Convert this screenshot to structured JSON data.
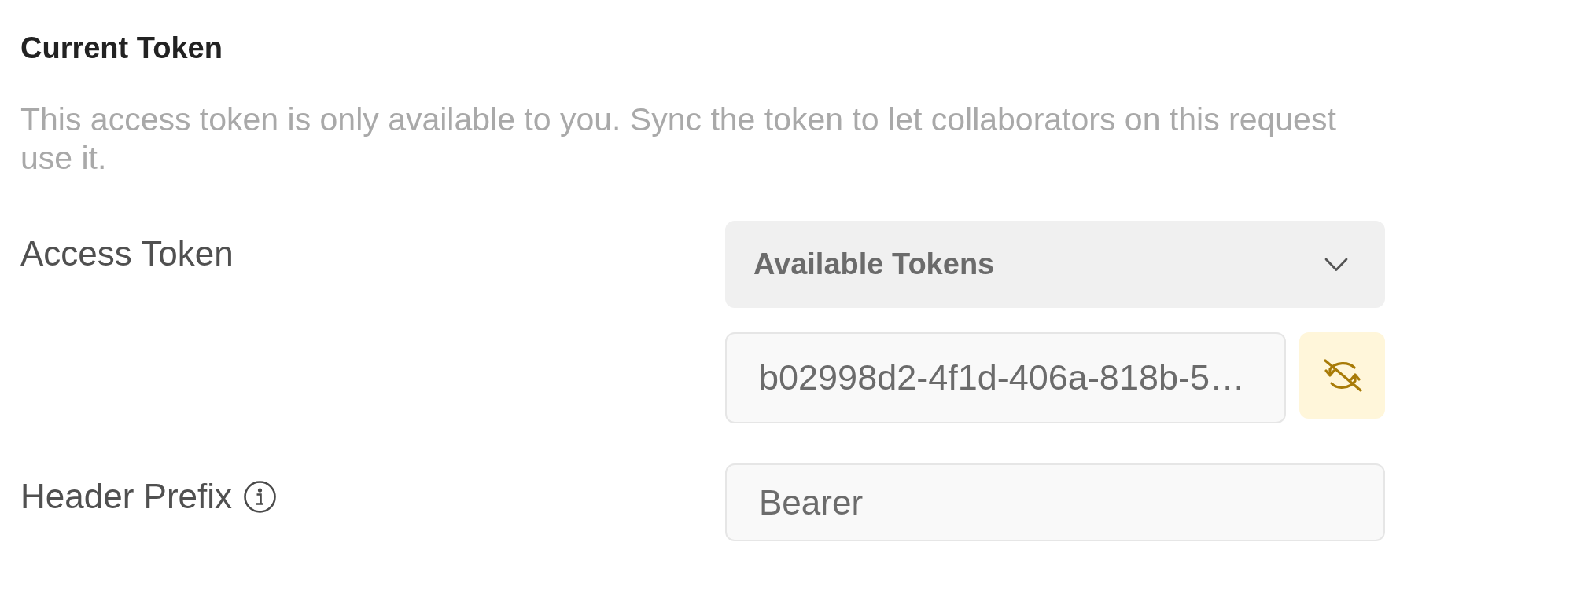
{
  "section": {
    "title": "Current Token",
    "description": "This access token is only available to you. Sync the token to let collaborators on this request use it."
  },
  "fields": [
    {
      "kind": "token",
      "label": "Access Token",
      "info": false,
      "dropdown": {
        "label": "Available Tokens"
      },
      "value": "b02998d2-4f1d-406a-818b-5…"
    },
    {
      "kind": "text",
      "label": "Header Prefix",
      "info": true,
      "value": "Bearer"
    }
  ]
}
